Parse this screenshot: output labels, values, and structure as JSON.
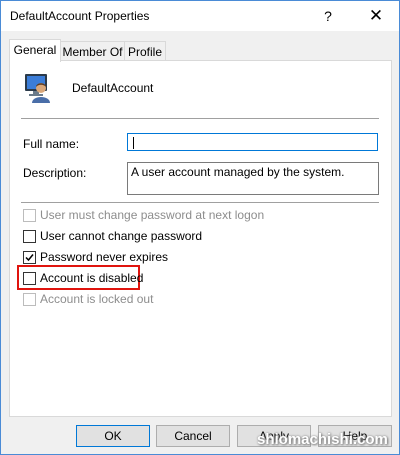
{
  "window": {
    "title": "DefaultAccount Properties",
    "help_glyph": "?",
    "close_glyph": "✕"
  },
  "tabs": [
    {
      "label": "General",
      "active": true
    },
    {
      "label": "Member Of",
      "active": false
    },
    {
      "label": "Profile",
      "active": false
    }
  ],
  "account": {
    "name": "DefaultAccount",
    "icon": "user-account-icon"
  },
  "fields": {
    "full_name_label": "Full name:",
    "full_name_value": "",
    "description_label": "Description:",
    "description_value": "A user account managed by the system."
  },
  "options": [
    {
      "label": "User must change password at next logon",
      "checked": false,
      "enabled": false
    },
    {
      "label": "User cannot change password",
      "checked": false,
      "enabled": true
    },
    {
      "label": "Password never expires",
      "checked": true,
      "enabled": true
    },
    {
      "label": "Account is disabled",
      "checked": false,
      "enabled": true,
      "highlighted": true
    },
    {
      "label": "Account is locked out",
      "checked": false,
      "enabled": false
    }
  ],
  "buttons": {
    "ok": "OK",
    "cancel": "Cancel",
    "apply": "Apply",
    "help": "Help"
  },
  "watermark": "shiomachishi.com",
  "colors": {
    "accent": "#0078d7",
    "highlight": "#e0140e",
    "window_border": "#4a8bd6"
  }
}
